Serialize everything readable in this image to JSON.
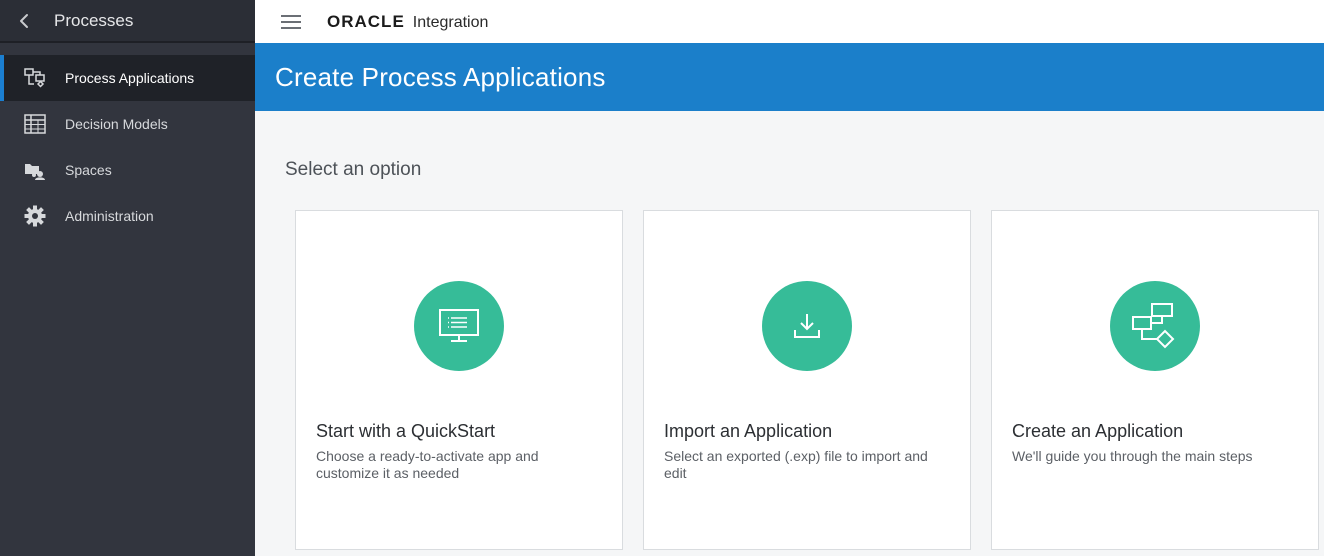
{
  "sidebar": {
    "title": "Processes",
    "items": [
      {
        "label": "Process Applications",
        "icon": "process-flow-icon",
        "active": true
      },
      {
        "label": "Decision Models",
        "icon": "table-grid-icon",
        "active": false
      },
      {
        "label": "Spaces",
        "icon": "spaces-folder-icon",
        "active": false
      },
      {
        "label": "Administration",
        "icon": "gear-icon",
        "active": false
      }
    ]
  },
  "topbar": {
    "brand": "ORACLE",
    "product": "Integration"
  },
  "banner": {
    "title": "Create Process Applications"
  },
  "main": {
    "section_title": "Select an option",
    "cards": [
      {
        "title": "Start with a QuickStart",
        "description": "Choose a ready-to-activate app and customize it as needed",
        "icon": "monitor-icon"
      },
      {
        "title": "Import an Application",
        "description": "Select an exported (.exp) file to import and edit",
        "icon": "download-icon"
      },
      {
        "title": "Create an Application",
        "description": "We'll guide you through the main steps",
        "icon": "flow-diagram-icon"
      }
    ]
  },
  "colors": {
    "sidebar_bg": "#32353e",
    "banner_bg": "#1b7fca",
    "accent_green": "#36bc98",
    "active_indicator": "#1b7fd1"
  }
}
